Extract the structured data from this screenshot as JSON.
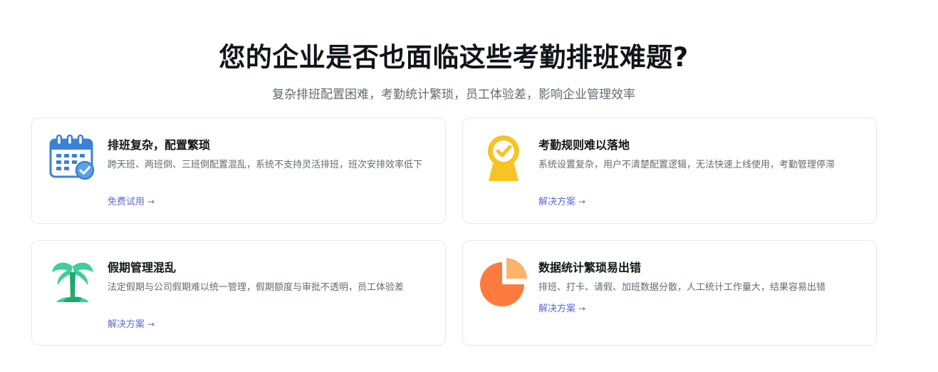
{
  "header": {
    "title": "您的企业是否也面临这些考勤排班难题?",
    "subtitle": "复杂排班配置困难，考勤统计繁琐，员工体验差，影响企业管理效率"
  },
  "cards": [
    {
      "title": "排班复杂，配置繁琐",
      "desc": "跨天班、两班倒、三班倒配置混乱，系统不支持灵活排班，班次安排效率低下",
      "link": "免费试用",
      "icon": "calendar-check-icon",
      "color": "#3b82d6"
    },
    {
      "title": "考勤规则难以落地",
      "desc": "系统设置复杂，用户不清楚配置逻辑，无法快速上线使用，考勤管理停滞",
      "link": "解决方案",
      "icon": "location-check-icon",
      "color": "#f7c325"
    },
    {
      "title": "假期管理混乱",
      "desc": "法定假期与公司假期难以统一管理，假期额度与审批不透明，员工体验差",
      "link": "解决方案",
      "icon": "palm-tree-icon",
      "color": "#3ecf9a"
    },
    {
      "title": "数据统计繁琐易出错",
      "desc": "排班、打卡、请假、加班数据分散，人工统计工作量大，结果容易出错",
      "link": "解决方案",
      "icon": "pie-chart-icon",
      "color": "#ff7a3d"
    }
  ],
  "arrow_glyph": "→"
}
